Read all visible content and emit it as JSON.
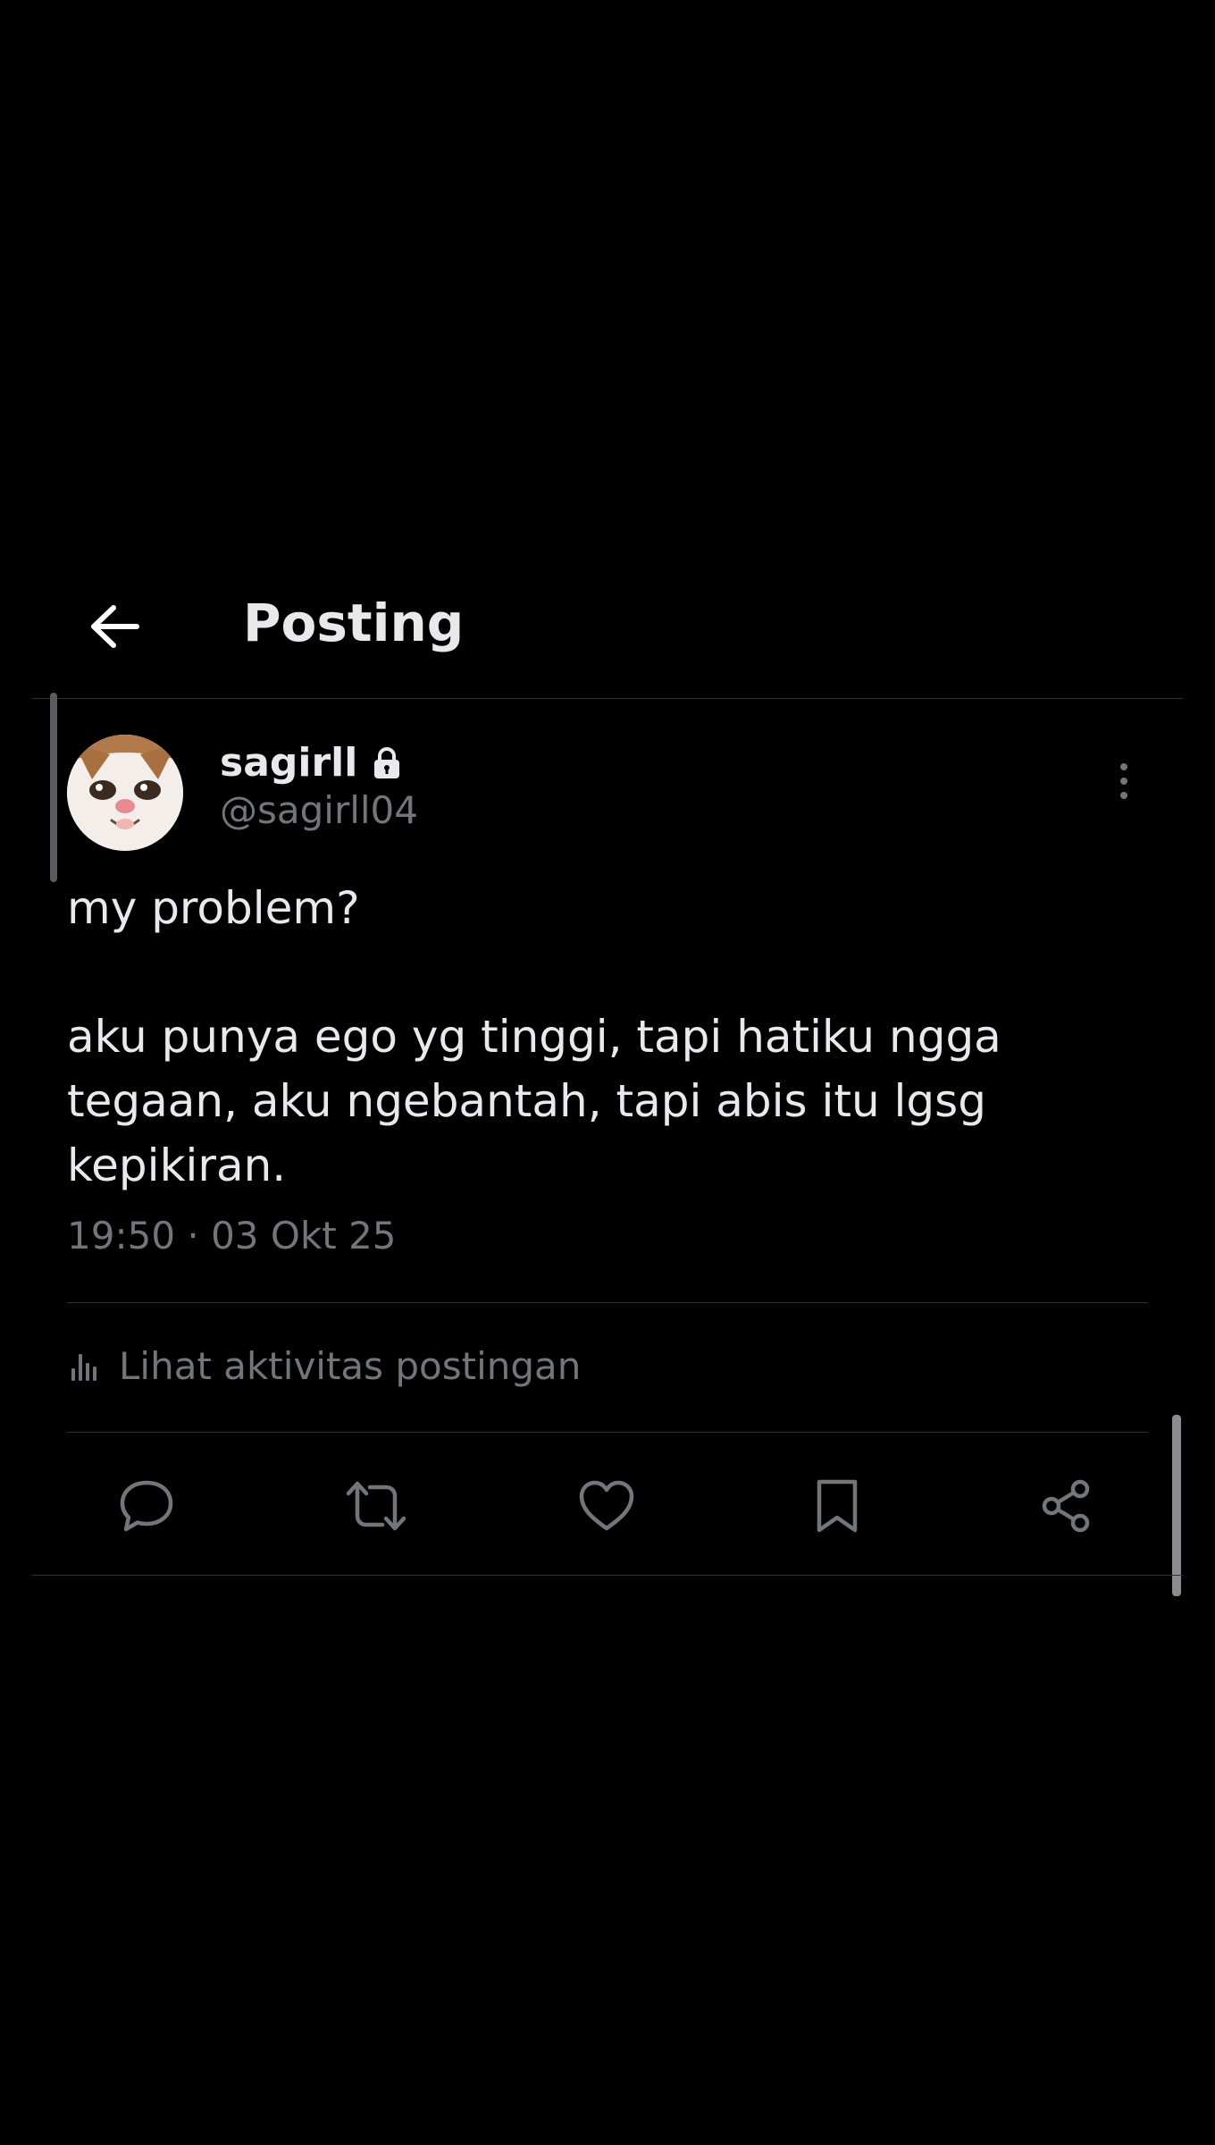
{
  "header": {
    "title": "Posting",
    "back_icon": "arrow-left-icon"
  },
  "post": {
    "author": {
      "display_name": "sagirll",
      "handle": "@sagirll04",
      "protected_icon": "lock-icon",
      "avatar": "cat-face-avatar"
    },
    "more_icon": "more-vertical-icon",
    "text": "my problem?\n\naku punya ego yg tinggi, tapi hatiku ngga tegaan, aku ngebantah, tapi abis itu lgsg kepikiran.",
    "timestamp": "19:50 · 03 Okt 25",
    "activity": {
      "icon": "bar-chart-icon",
      "label": "Lihat aktivitas postingan"
    },
    "actions": [
      {
        "name": "reply",
        "icon": "reply-icon"
      },
      {
        "name": "repost",
        "icon": "repost-icon"
      },
      {
        "name": "like",
        "icon": "heart-icon"
      },
      {
        "name": "bookmark",
        "icon": "bookmark-icon"
      },
      {
        "name": "share",
        "icon": "share-icon"
      }
    ]
  },
  "colors": {
    "background": "#000000",
    "primary_text": "#e7e9ea",
    "secondary_text": "#71767b",
    "divider": "#2f3336"
  }
}
